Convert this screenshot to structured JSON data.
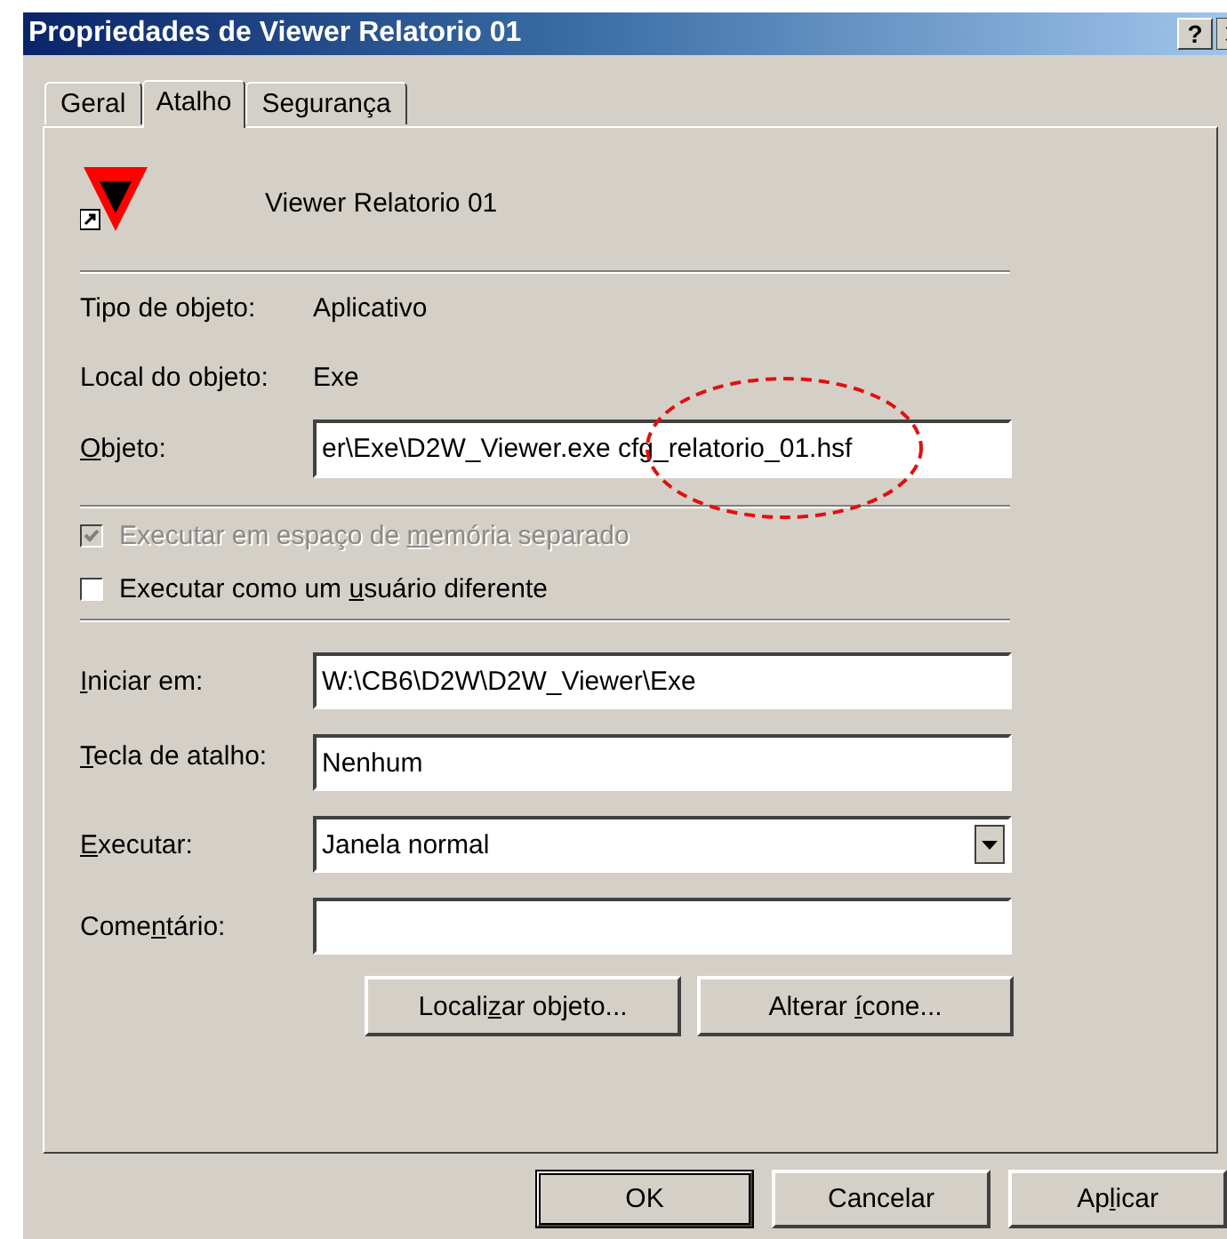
{
  "window": {
    "title": "Propriedades de Viewer Relatorio 01",
    "help_button": "?"
  },
  "tabs": [
    {
      "label": "Geral",
      "selected": false
    },
    {
      "label": "Atalho",
      "selected": true
    },
    {
      "label": "Segurança",
      "selected": false
    }
  ],
  "shortcut": {
    "name": "Viewer Relatorio 01"
  },
  "info": [
    {
      "label": "Tipo de objeto:",
      "value": "Aplicativo"
    },
    {
      "label": "Local do objeto:",
      "value": "Exe"
    }
  ],
  "target": {
    "label": {
      "key": "O",
      "after": "bjeto:"
    },
    "value": "er\\Exe\\D2W_Viewer.exe cfg_relatorio_01.hsf",
    "circled": true
  },
  "options": [
    {
      "label": {
        "before": "Executar em espaço de ",
        "key": "m",
        "after": "emória separado"
      },
      "checked": true,
      "disabled": true
    },
    {
      "label": {
        "before": "Executar como um ",
        "key": "u",
        "after": "suário diferente"
      },
      "checked": false,
      "disabled": false
    }
  ],
  "fields": [
    {
      "kind": "text",
      "label": {
        "key": "I",
        "after": "niciar em:"
      },
      "value": "W:\\CB6\\D2W\\D2W_Viewer\\Exe"
    },
    {
      "kind": "text",
      "label": {
        "key": "T",
        "after": "ecla de atalho:"
      },
      "value": "Nenhum"
    },
    {
      "kind": "select",
      "label": {
        "key": "E",
        "after": "xecutar:"
      },
      "value": "Janela normal"
    },
    {
      "kind": "text",
      "label": {
        "before": "Come",
        "key": "n",
        "after": "tário:"
      }
    }
  ],
  "actions": [
    {
      "label": {
        "before": "Locali",
        "key": "z",
        "after": "ar objeto..."
      }
    },
    {
      "label": {
        "before": "Alterar ",
        "key": "í",
        "after": "cone..."
      }
    }
  ],
  "buttons": [
    {
      "label": {
        "before": "OK"
      },
      "default": true
    },
    {
      "label": {
        "before": "Cancelar"
      },
      "default": false
    },
    {
      "label": {
        "before": "Ap",
        "key": "l",
        "after": "icar"
      },
      "default": false
    }
  ]
}
